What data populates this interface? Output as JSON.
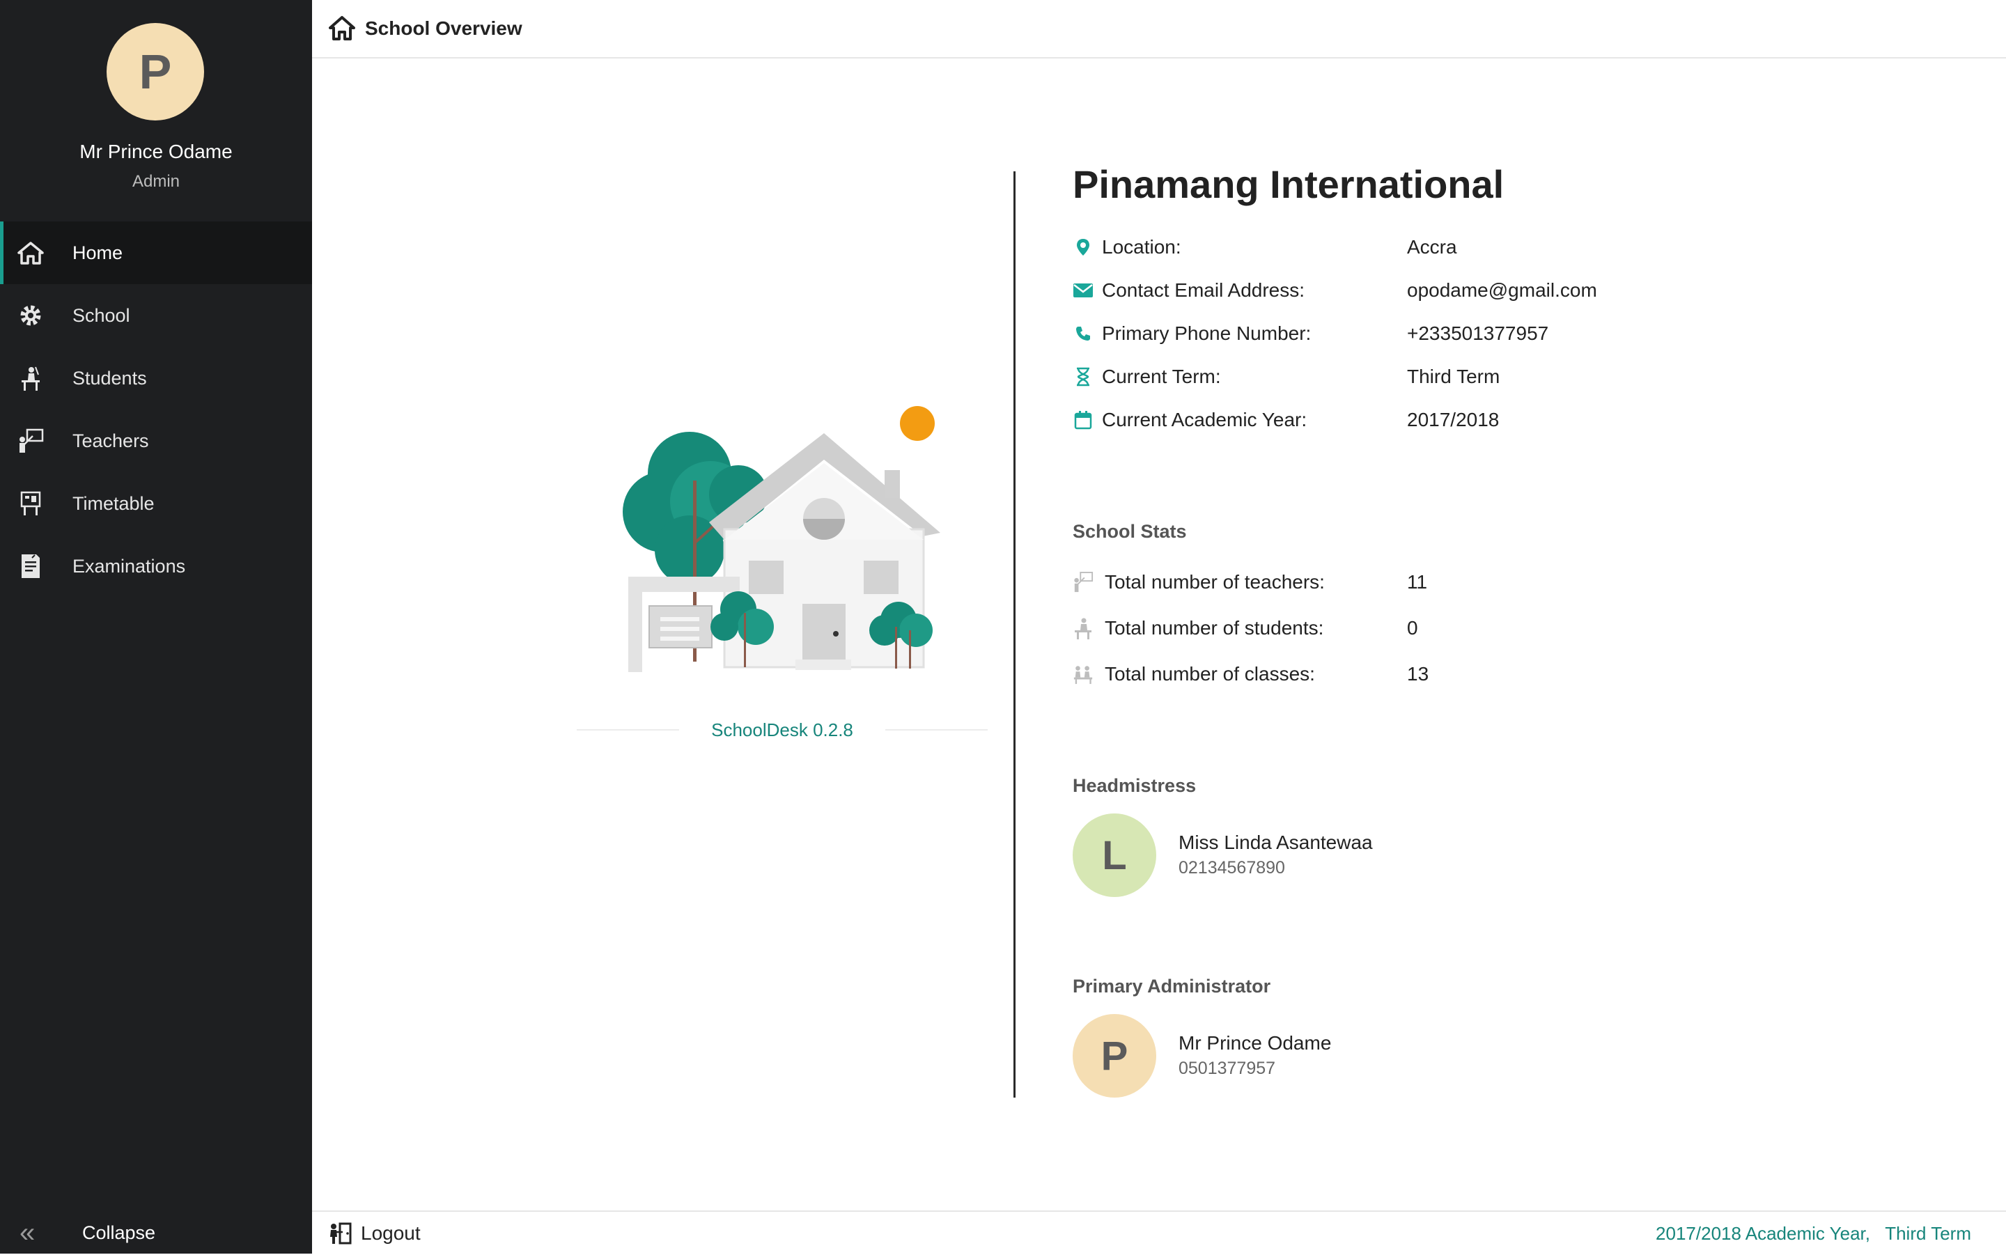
{
  "colors": {
    "sidebar_bg": "#1e1f21",
    "accent": "#1a9e8f",
    "footer_text": "#17857b",
    "admin_avatar_bg": "#f5deb3",
    "headmistress_avatar_bg": "#d7e7b4",
    "sun": "#f39c12"
  },
  "user": {
    "initial": "P",
    "name": "Mr Prince Odame",
    "role": "Admin"
  },
  "sidebar": {
    "items": [
      {
        "label": "Home",
        "icon": "home-icon",
        "active": true
      },
      {
        "label": "School",
        "icon": "gear-icon",
        "active": false
      },
      {
        "label": "Students",
        "icon": "student-icon",
        "active": false
      },
      {
        "label": "Teachers",
        "icon": "teacher-icon",
        "active": false
      },
      {
        "label": "Timetable",
        "icon": "timetable-icon",
        "active": false
      },
      {
        "label": "Examinations",
        "icon": "examination-icon",
        "active": false
      }
    ],
    "collapse_label": "Collapse"
  },
  "header": {
    "title": "School Overview",
    "icon": "home-icon"
  },
  "version": "SchoolDesk 0.2.8",
  "school": {
    "name": "Pinamang International",
    "details": [
      {
        "label": "Location:",
        "value": "Accra",
        "icon": "location-pin-icon"
      },
      {
        "label": "Contact Email Address:",
        "value": "opodame@gmail.com",
        "icon": "email-icon"
      },
      {
        "label": "Primary Phone Number:",
        "value": "+233501377957",
        "icon": "phone-icon"
      },
      {
        "label": "Current Term:",
        "value": "Third Term",
        "icon": "hourglass-icon"
      },
      {
        "label": "Current Academic Year:",
        "value": "2017/2018",
        "icon": "calendar-icon"
      }
    ]
  },
  "stats": {
    "title": "School Stats",
    "items": [
      {
        "label": "Total number of teachers:",
        "value": "11",
        "icon": "teacher-icon"
      },
      {
        "label": "Total number of students:",
        "value": "0",
        "icon": "student-icon"
      },
      {
        "label": "Total number of classes:",
        "value": "13",
        "icon": "classes-icon"
      }
    ]
  },
  "headmistress": {
    "title": "Headmistress",
    "initial": "L",
    "name": "Miss Linda Asantewaa",
    "phone": "02134567890"
  },
  "primary_admin": {
    "title": "Primary Administrator",
    "initial": "P",
    "name": "Mr Prince Odame",
    "phone": "0501377957"
  },
  "footer": {
    "logout_label": "Logout",
    "academic_year": "2017/2018 Academic Year,",
    "term": "Third Term"
  }
}
